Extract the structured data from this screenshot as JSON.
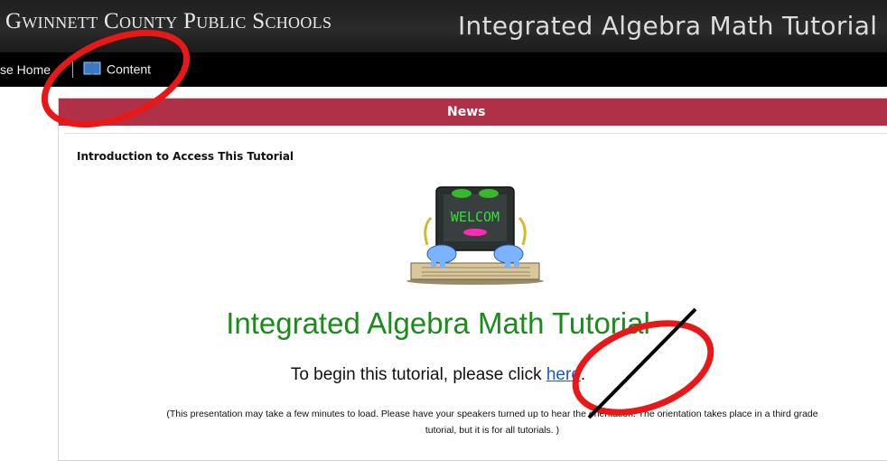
{
  "header": {
    "org_name": "Gwinnett County Public Schools",
    "course_title": "Integrated Algebra Math Tutorial"
  },
  "nav": {
    "home_label": "se Home",
    "content_label": "Content",
    "content_icon": "book-icon"
  },
  "news": {
    "header": "News",
    "intro_heading": "Introduction to Access This Tutorial",
    "mascot_screen_text": "WELCOM",
    "tutorial_title": "Integrated Algebra Math Tutorial",
    "begin_prefix": "To begin this tutorial, please click ",
    "begin_link": "here",
    "begin_suffix": ".",
    "note_line1": "(This presentation may take a few minutes to load.  Please have your speakers turned up to hear the orientation.  The orientation takes place in a third grade",
    "note_line2": "tutorial, but it is for all tutorials. )"
  },
  "colors": {
    "news_bar": "#b03048",
    "title_green": "#1a8c1a",
    "link_blue": "#1a55d6",
    "annotation_red": "#e81818"
  }
}
